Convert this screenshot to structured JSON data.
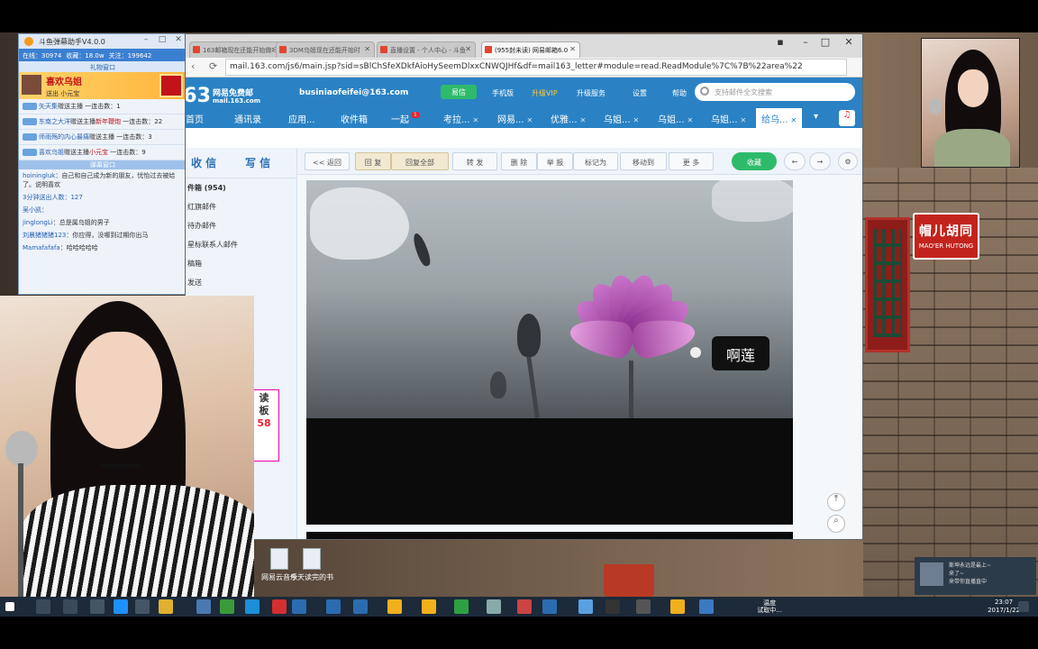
{
  "helper": {
    "title": "斗鱼弹幕助手V4.0.0",
    "stats": {
      "online": "在线：30974",
      "fans": "收藏：18.0w",
      "follow": "关注：199642"
    },
    "gift_bar": "礼物窗口",
    "banner": {
      "title": "喜欢乌姐",
      "sub_from": "送出",
      "sub_gift": "小元宝"
    },
    "gift_msgs": [
      {
        "name": "矢天集",
        "text": "赠送主播",
        "count": "一连击数：1"
      },
      {
        "name": "东南之大洋",
        "text": "赠送主播",
        "extra": "新年鞭炮",
        "count": "一连击数：22"
      },
      {
        "name": "师雨殇的内心最痛",
        "text": "赠送主播",
        "count": "一连击数：3"
      },
      {
        "name": "喜欢乌姐",
        "text": "赠送主播",
        "extra": "小元宝",
        "count": "一连击数：9"
      }
    ],
    "chat_bar": "弹幕窗口",
    "chat": [
      {
        "name": "hoiningluk",
        "text": "自己和自己成为新的朋友，忧怡过去被给了。说明喜欢"
      },
      {
        "name": "",
        "text": "3分钟送出人数：127"
      },
      {
        "name": "吴小凯",
        "text": ""
      },
      {
        "name": "jinglongLi",
        "text": "总是属乌姐的男子"
      },
      {
        "name": "刘晨猪猪猪123",
        "text": "你应得，没哪到过期你出马"
      },
      {
        "name": "Mamafafafa",
        "text": "哈哈哈哈哈"
      }
    ]
  },
  "browser": {
    "tabs": [
      {
        "label": "163邮箱现在还能开始做吗"
      },
      {
        "label": "3DM乌姐现在还能开始时"
      },
      {
        "label": "直播设置 - 个人中心 - 斗鱼"
      },
      {
        "label": "(955封未读) 网易邮箱6.0"
      }
    ],
    "url": "mail.163.com/js6/main.jsp?sid=sBlChSfeXDkfAioHySeemDlxxCNWQJHf&df=mail163_letter#module=read.ReadModule%7C%7B%22area%22"
  },
  "mail": {
    "logo_num": "163",
    "logo_sub1": "网易免费邮",
    "logo_sub2": "mail.163.com",
    "account": "businiaofeifei@163.com",
    "yixin": "易信",
    "links": [
      "手机版",
      "升级VIP",
      "升级服务",
      "设置",
      "帮助"
    ],
    "search_placeholder": "支持邮件全文搜索",
    "nav_tabs": [
      {
        "label": "首页"
      },
      {
        "label": "通讯录"
      },
      {
        "label": "应用..."
      },
      {
        "label": "收件箱"
      },
      {
        "label": "一起",
        "badge": "1"
      },
      {
        "label": "考拉..."
      },
      {
        "label": "网易..."
      },
      {
        "label": "优雅..."
      },
      {
        "label": "乌姐..."
      },
      {
        "label": "乌姐..."
      },
      {
        "label": "乌姐..."
      },
      {
        "label": "给乌..."
      }
    ],
    "side": {
      "receive": "收 信",
      "compose": "写 信",
      "folders": [
        "件箱 (954)",
        "红旗邮件",
        "待办邮件",
        "星标联系人邮件",
        "稿箱",
        "发送",
        "圾邮件 (1)"
      ],
      "promo": [
        "读",
        "板",
        "58"
      ]
    },
    "toolbar": {
      "back": "<< 返回",
      "reply": "回 复",
      "reply_all": "回复全部",
      "forward": "转 发",
      "delete": "删 除",
      "report": "举 报",
      "mark": "标记为",
      "move": "移动到",
      "more": "更 多",
      "collect": "收藏"
    },
    "caption": "啊莲"
  },
  "desktop": {
    "sign_cn": "帽儿胡同",
    "sign_en": "MAO'ER HUTONG",
    "icons": [
      "网易云音乐",
      "今天读完的书"
    ]
  },
  "taskbar": {
    "tray": [
      "温度",
      "试取中..."
    ],
    "time": "23:07",
    "date": "2017/1/22"
  },
  "notification": {
    "line1": "斯坤永远是最上~",
    "line2": "来了~",
    "line3": "来带你直播直中"
  }
}
